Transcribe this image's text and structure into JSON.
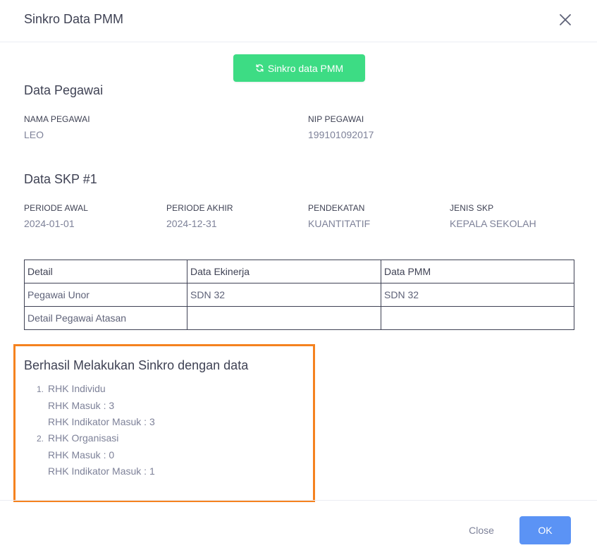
{
  "modal": {
    "title": "Sinkro Data PMM",
    "sync_button_label": "Sinkro data PMM"
  },
  "pegawai": {
    "section_title": "Data Pegawai",
    "nama_label": "NAMA PEGAWAI",
    "nama_value": "LEO",
    "nip_label": "NIP PEGAWAI",
    "nip_value": "199101092017"
  },
  "skp": {
    "section_title": "Data SKP #1",
    "periode_awal_label": "PERIODE AWAL",
    "periode_awal_value": "2024-01-01",
    "periode_akhir_label": "PERIODE AKHIR",
    "periode_akhir_value": "2024-12-31",
    "pendekatan_label": "PENDEKATAN",
    "pendekatan_value": "KUANTITATIF",
    "jenis_label": "JENIS SKP",
    "jenis_value": "KEPALA SEKOLAH"
  },
  "table": {
    "headers": [
      "Detail",
      "Data Ekinerja",
      "Data PMM"
    ],
    "rows": [
      [
        "Pegawai Unor",
        "SDN 32",
        "SDN 32"
      ],
      [
        "Detail Pegawai Atasan",
        "",
        ""
      ]
    ]
  },
  "result": {
    "title": "Berhasil Melakukan Sinkro dengan data",
    "items": [
      {
        "num": "1.",
        "name": "RHK Individu",
        "masuk": "RHK Masuk : 3",
        "indikator": "RHK Indikator Masuk : 3"
      },
      {
        "num": "2.",
        "name": "RHK Organisasi",
        "masuk": "RHK Masuk : 0",
        "indikator": "RHK Indikator Masuk : 1"
      }
    ]
  },
  "footer": {
    "close_label": "Close",
    "ok_label": "OK"
  },
  "colors": {
    "sync_button": "#3ddc84",
    "ok_button": "#5b93f5",
    "highlight_border": "#f5821f"
  },
  "icons": {
    "close": "close-icon",
    "sync": "sync-icon"
  }
}
